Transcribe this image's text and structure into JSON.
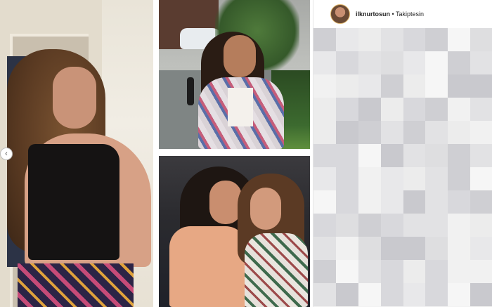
{
  "instagram_post": {
    "username": "ilknurtosun",
    "separator": " • ",
    "follow_status": "Takiptesin"
  },
  "carousel": {
    "prev_icon": "chevron-left-icon",
    "prev_glyph": "‹"
  },
  "watermark": {
    "text": "◎"
  },
  "colors": {
    "avatar_ring": "#e0b66a",
    "blur_dark": "#cfcfd3",
    "blur_light": "#f4f4f4"
  }
}
